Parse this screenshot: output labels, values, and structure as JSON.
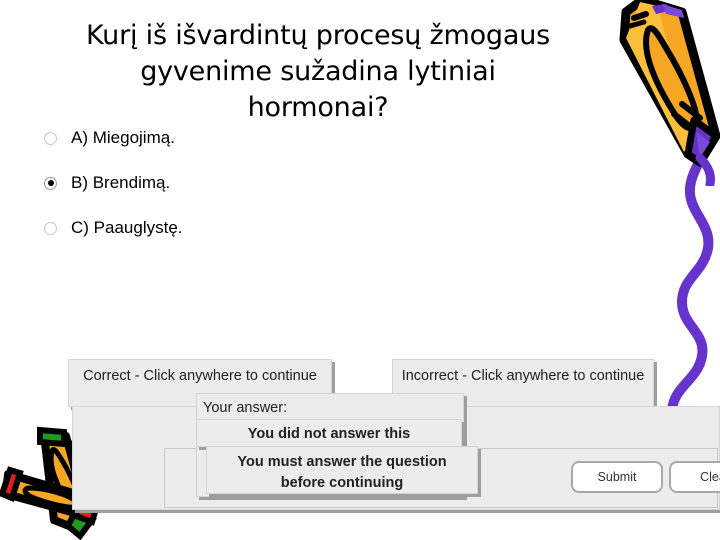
{
  "slide": {
    "title": "Kurį iš išvardintų procesų žmogaus\ngyvenime sužadina lytiniai\nhormonai?",
    "background_color": "#ffffff"
  },
  "choices": [
    {
      "id": "A",
      "label": "A) Miegojimą.",
      "selected": false
    },
    {
      "id": "B",
      "label": "B) Brendimą.",
      "selected": true
    },
    {
      "id": "C",
      "label": "C) Paauglystę.",
      "selected": false
    }
  ],
  "feedback": {
    "correct": "Correct - Click anywhere to continue",
    "incorrect": "Incorrect - Click anywhere to continue",
    "your_answer": "Your answer:",
    "no_answer": "You did not answer this",
    "must_answer": "You must answer the question\nbefore continuing"
  },
  "buttons": {
    "submit": "Submit",
    "clear": "Clear"
  },
  "icons": {
    "radio_unselected": "radio-unselected-icon",
    "radio_selected": "radio-selected-icon",
    "crayon_top_right": "crayon-icon",
    "crayon_pair": "crayon-pair-icon",
    "squiggle": "squiggle-line-icon"
  },
  "colors": {
    "crayon_body": "#F5A623",
    "crayon_body_light": "#FBBF3B",
    "crayon_outline": "#000000",
    "crayon_tip_purple": "#6633CC",
    "crayon_tip_red": "#E02020",
    "crayon_tip_green": "#1E9B1E",
    "squiggle_purple": "#6633CC",
    "dialog_bg": "#ECECED",
    "dialog_border": "#D4D4D4",
    "dialog_shadow": "#9E9E9E",
    "button_bg": "#FFFFFF",
    "button_border": "#A8A8A8",
    "text": "#000000"
  }
}
